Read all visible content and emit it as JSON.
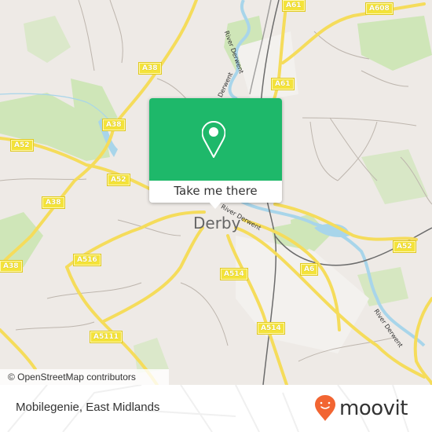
{
  "map": {
    "city_label": "Derby",
    "attribution": "© OpenStreetMap contributors",
    "road_labels": [
      "A38",
      "A38",
      "A52",
      "A52",
      "A38",
      "A38",
      "A516",
      "A5111",
      "A61",
      "A61",
      "A608",
      "A514",
      "A514",
      "A6",
      "A52"
    ],
    "river_labels": [
      "River Derwent",
      "River Derwent",
      "River Derwent",
      "River Derwent"
    ],
    "colors": {
      "background": "#eeeae6",
      "park": "#cde8b5",
      "water": "#a8d5ea",
      "major_road": "#f7e35e",
      "minor_road": "#b8b0a8",
      "railway": "#666666"
    }
  },
  "popup": {
    "icon": "location-pin-icon",
    "button_label": "Take me there",
    "color": "#1eb86a"
  },
  "footer": {
    "location_name": "Mobilegenie, East Midlands",
    "brand": "moovit",
    "brand_icon": "moovit-pin-smile-icon",
    "brand_color": "#f26532"
  }
}
